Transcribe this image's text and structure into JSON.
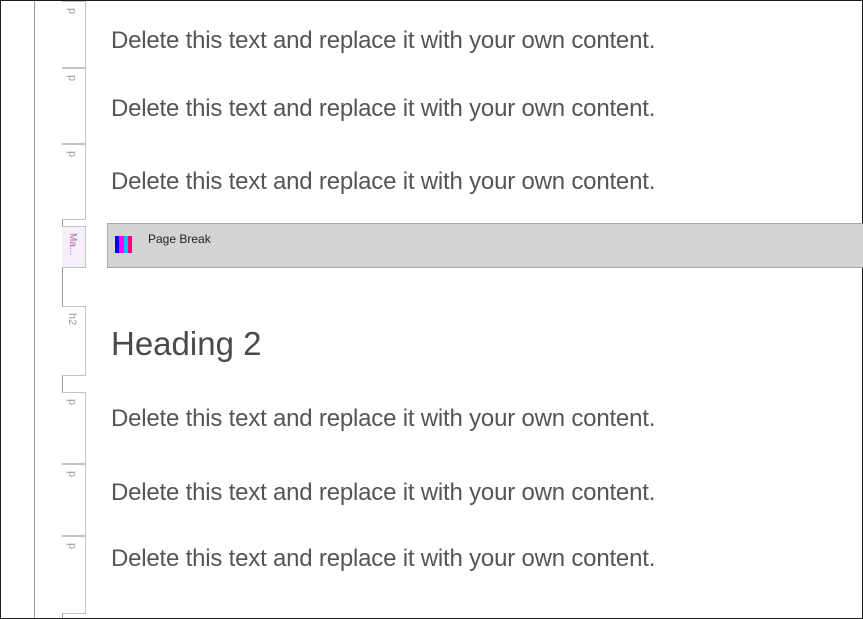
{
  "paragraphs_top": [
    {
      "tag": "p",
      "text": "Delete this text and replace it with your own content."
    },
    {
      "tag": "p",
      "text": "Delete this text and replace it with your own content."
    },
    {
      "tag": "p",
      "text": "Delete this text and replace it with your own content."
    }
  ],
  "page_break": {
    "tag": "Ma...",
    "label": "Page Break",
    "icon": "page-break-icon",
    "icon_colors": [
      "#0000ff",
      "#ff00ff",
      "#00c0ff",
      "#ff0080"
    ]
  },
  "heading": {
    "tag": "h2",
    "text": "Heading 2"
  },
  "paragraphs_bottom": [
    {
      "tag": "p",
      "text": "Delete this text and replace it with your own content."
    },
    {
      "tag": "p",
      "text": "Delete this text and replace it with your own content."
    },
    {
      "tag": "p",
      "text": "Delete this text and replace it with your own content."
    }
  ]
}
